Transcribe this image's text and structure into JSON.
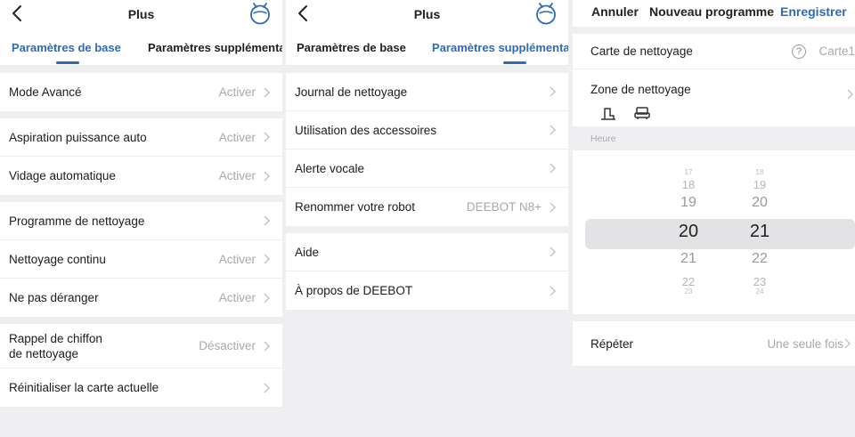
{
  "screen1": {
    "title": "Plus",
    "tabs": [
      "Paramètres de base",
      "Paramètres supplémentaires"
    ],
    "groups": [
      [
        {
          "label": "Mode Avancé",
          "value": "Activer"
        }
      ],
      [
        {
          "label": "Aspiration puissance auto",
          "value": "Activer"
        },
        {
          "label": "Vidage automatique",
          "value": "Activer"
        }
      ],
      [
        {
          "label": "Programme de nettoyage",
          "value": ""
        },
        {
          "label": "Nettoyage continu",
          "value": "Activer"
        },
        {
          "label": "Ne pas déranger",
          "value": "Activer"
        }
      ],
      [
        {
          "label": "Rappel de chiffon",
          "label2": "de nettoyage",
          "value": "Désactiver"
        },
        {
          "label": "Réinitialiser la carte actuelle",
          "value": ""
        }
      ]
    ]
  },
  "screen2": {
    "title": "Plus",
    "tabs": [
      "Paramètres de base",
      "Paramètres supplémentaires"
    ],
    "groups": [
      [
        {
          "label": "Journal de nettoyage",
          "value": ""
        },
        {
          "label": "Utilisation des accessoires",
          "value": ""
        },
        {
          "label": "Alerte vocale",
          "value": ""
        },
        {
          "label": "Renommer votre robot",
          "value": "DEEBOT N8+"
        }
      ],
      [
        {
          "label": "Aide",
          "value": ""
        },
        {
          "label": "À propos de DEEBOT",
          "value": ""
        }
      ]
    ]
  },
  "screen3": {
    "cancel": "Annuler",
    "title": "Nouveau programme",
    "save": "Enregistrer",
    "map_label": "Carte de nettoyage",
    "map_value": "Carte1",
    "help_symbol": "?",
    "zone_label": "Zone de nettoyage",
    "zone_icons": [
      "room-icon",
      "sofa-icon"
    ],
    "time_label": "Heure",
    "hours": [
      "17",
      "18",
      "19",
      "20",
      "21",
      "22",
      "23"
    ],
    "minutes": [
      "18",
      "19",
      "20",
      "21",
      "22",
      "23",
      "24"
    ],
    "selected_hour": "20",
    "selected_minute": "21",
    "repeat_label": "Répéter",
    "repeat_value": "Une seule fois"
  },
  "colors": {
    "accent": "#2d6bb5",
    "background": "#efeff2",
    "muted": "#a9a9ad"
  }
}
